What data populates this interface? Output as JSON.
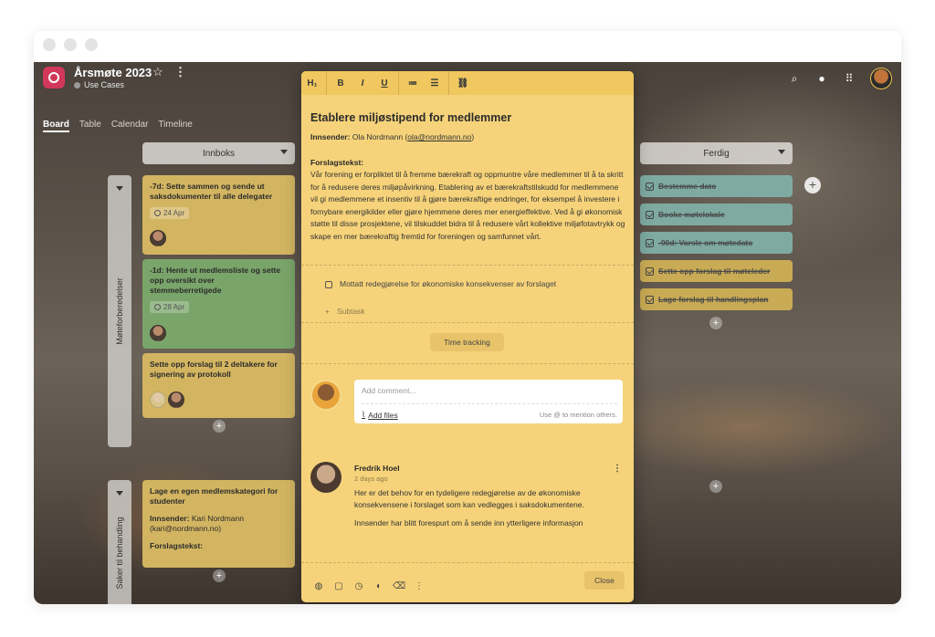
{
  "project": {
    "title": "Årsmøte 2023",
    "subtitle": "Use Cases"
  },
  "tabs": [
    {
      "label": "Board"
    },
    {
      "label": "Table"
    },
    {
      "label": "Calendar"
    },
    {
      "label": "Timeline"
    }
  ],
  "columns": {
    "inbox": "Innboks",
    "done": "Ferdig"
  },
  "lanes": [
    {
      "label": "Møteforberedelser"
    },
    {
      "label": "Saker til behandling"
    }
  ],
  "cards": [
    {
      "title": "-7d: Sette sammen og sende ut saksdokumenter til alle delegater",
      "date": "24 Apr"
    },
    {
      "title": "-1d: Hente ut medlemsliste og sette opp oversikt over stemmeberretigede",
      "date": "28 Apr"
    },
    {
      "title": "Sette opp forslag til 2 deltakere for signering av protokoll"
    },
    {
      "title": "Lage en egen medlemskategori for studenter",
      "submitter_label": "Innsender:",
      "submitter": "Kari Nordmann (kari@nordmann.no)",
      "proposal_label": "Forslagstekst:"
    }
  ],
  "done_cards": [
    {
      "title": "Bestemme dato"
    },
    {
      "title": "Booke møtelokale"
    },
    {
      "title": "-90d: Varsle om møtedato"
    },
    {
      "title": "Sette opp forslag til møteleder"
    },
    {
      "title": "Lage forslag til handlingsplan"
    }
  ],
  "modal": {
    "toolbar": {
      "h1": "H₁",
      "bold": "B",
      "italic": "I",
      "underline": "U"
    },
    "title": "Etablere miljøstipend for medlemmer",
    "submitter_label": "Innsender:",
    "submitter_name": "Ola Nordmann (",
    "submitter_email": "ola@nordmann.no",
    "submitter_close": ")",
    "proposal_label": "Forslagstekst:",
    "proposal_text": "Vår forening er forpliktet til å fremme bærekraft og oppmuntre våre medlemmer til å ta skritt for å redusere deres miljøpåvirkning. Etablering av et bærekraftstilskudd for medlemmene vil gi medlemmene et insentiv til å gjøre bærekraftige endringer, for eksempel å investere i fornybare energikilder eller gjøre hjemmene deres mer energieffektive. Ved å gi økonomisk støtte til disse prosjektene, vil tilskuddet bidra til å redusere vårt kollektive miljøfotavtrykk og skape en mer bærekraftig fremtid for foreningen og samfunnet vårt.",
    "subtask_text": "Mottatt redegjørelse for økonomiske konsekvenser av forslaget",
    "add_subtask": "Subtask",
    "time_tracking": "Time tracking",
    "comment_placeholder": "Add comment...",
    "add_files": "Add files",
    "mention_hint": "Use @ to mention others.",
    "comment": {
      "author": "Fredrik Hoel",
      "time": "2 days ago",
      "text": "Her er det behov for en tydeligere redegjørelse av de økonomiske konsekvensene i forslaget som kan vedlegges i saksdokumentene.",
      "text2": "Innsender har blitt forespurt om å sende inn ytterligere informasjon"
    },
    "close": "Close"
  },
  "colors": {
    "card_yellow": "#d3b561",
    "card_green": "#7aa56a",
    "done_teal": "#7eaaa2",
    "modal_bg": "#f6d37a",
    "app_logo": "#d1385a"
  },
  "icons": [
    "star-icon",
    "more-icon",
    "search-icon",
    "bell-icon",
    "grid-icon",
    "clock-icon",
    "check-icon",
    "plus-icon",
    "link-icon",
    "paperclip-icon",
    "trash-icon",
    "palette-icon"
  ]
}
